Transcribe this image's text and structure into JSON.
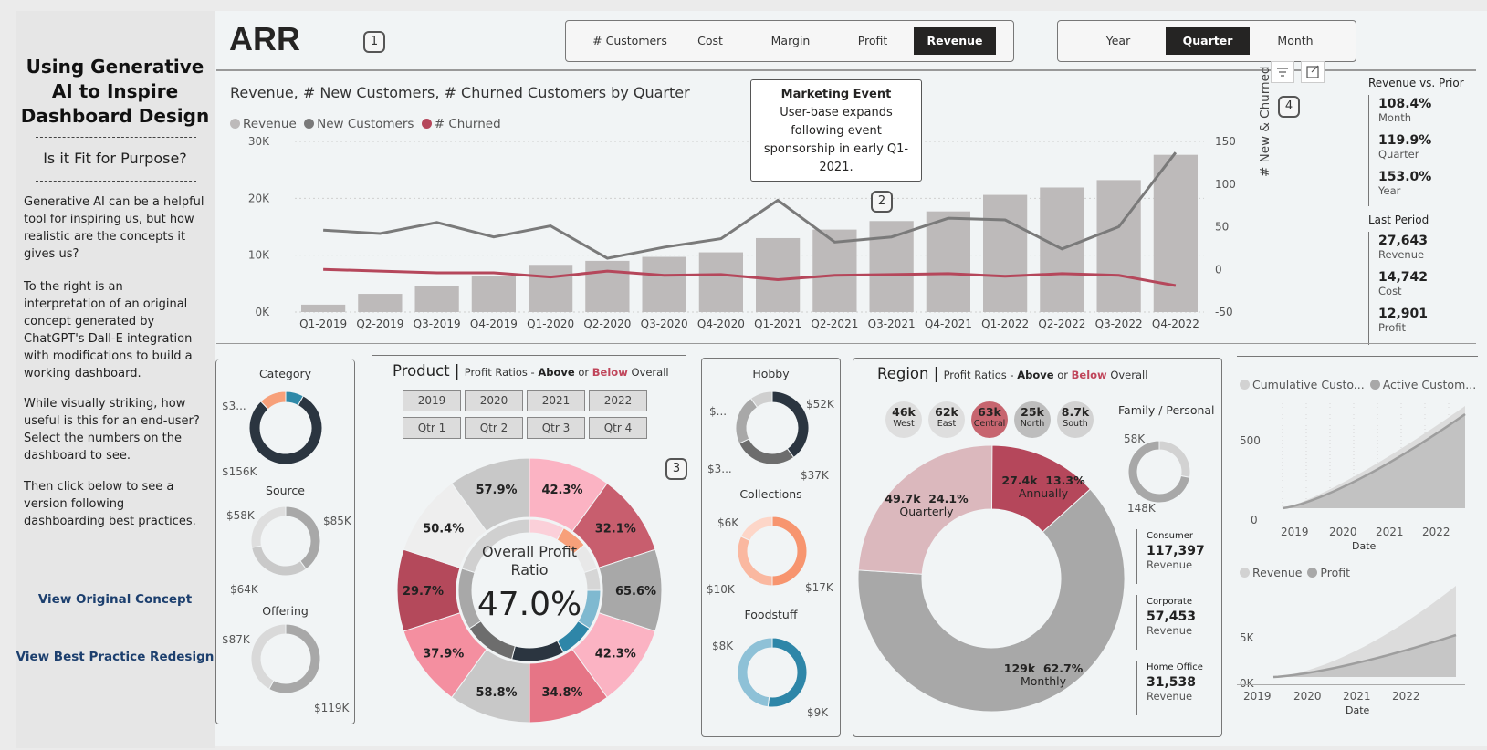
{
  "sidebar": {
    "title_lines": [
      "Using Generative",
      "AI to Inspire",
      "Dashboard Design"
    ],
    "subtitle": "Is it Fit for Purpose?",
    "para1": "Generative AI can be a helpful tool for inspiring us, but how realistic are the concepts it gives us?",
    "para2": "To the right is an interpretation of an original concept generated by ChatGPT's Dall-E integration with modifications to build a working dashboard.",
    "para3": "While visually striking, how useful is this for an end-user? Select the numbers on the dashboard to see.",
    "para4": "Then click below to see a version following dashboarding best practices.",
    "link_original": "View Original Concept",
    "link_redesign": "View Best Practice Redesign"
  },
  "header": {
    "title": "ARR",
    "badges": [
      "1",
      "2",
      "3",
      "4"
    ],
    "metric_buttons": [
      "# Customers",
      "Cost",
      "Margin",
      "Profit",
      "Revenue"
    ],
    "metric_active": "Revenue",
    "period_buttons": [
      "Year",
      "Quarter",
      "Month"
    ],
    "period_active": "Quarter"
  },
  "main_chart": {
    "title": "Revenue, # New Customers, # Churned Customers by Quarter",
    "legend": [
      {
        "label": "Revenue",
        "color": "#bdbaba"
      },
      {
        "label": "New Customers",
        "color": "#7a7a7a"
      },
      {
        "label": "# Churned",
        "color": "#b5475b"
      }
    ],
    "y_left_ticks": [
      "30K",
      "20K",
      "10K",
      "0K"
    ],
    "y_right_ticks": [
      "150",
      "100",
      "50",
      "0",
      "-50"
    ],
    "y_right_label": "# New & Churned",
    "annotation": {
      "title": "Marketing Event",
      "lines": [
        "User-base expands",
        "following event",
        "sponsorship in early Q1-",
        "2021."
      ]
    }
  },
  "chart_data": {
    "type": "bar",
    "categories": [
      "Q1-2019",
      "Q2-2019",
      "Q3-2019",
      "Q4-2019",
      "Q1-2020",
      "Q2-2020",
      "Q3-2020",
      "Q4-2020",
      "Q1-2021",
      "Q2-2021",
      "Q3-2021",
      "Q4-2021",
      "Q1-2022",
      "Q2-2022",
      "Q3-2022",
      "Q4-2022"
    ],
    "series": [
      {
        "name": "Revenue",
        "type": "bar",
        "values": [
          1300,
          3200,
          4600,
          6300,
          8300,
          9000,
          9700,
          10500,
          13000,
          14500,
          16000,
          17700,
          20600,
          21900,
          23200,
          27643
        ]
      },
      {
        "name": "New Customers",
        "type": "line",
        "values": [
          46,
          42,
          55,
          38,
          51,
          13,
          26,
          36,
          81,
          32,
          38,
          60,
          58,
          24,
          50,
          137
        ]
      },
      {
        "name": "# Churned",
        "type": "line",
        "values": [
          0,
          -2,
          -4,
          -4,
          -9,
          -2,
          -7,
          -6,
          -12,
          -7,
          -6,
          -5,
          -8,
          -5,
          -7,
          -19
        ]
      }
    ],
    "ylim": [
      0,
      30000
    ],
    "y2lim": [
      -50,
      150
    ],
    "ylabel": "",
    "y2label": "# New & Churned"
  },
  "kpis": {
    "header": "Revenue vs. Prior",
    "items": [
      {
        "value": "108.4%",
        "label": "Month"
      },
      {
        "value": "119.9%",
        "label": "Quarter"
      },
      {
        "value": "153.0%",
        "label": "Year"
      }
    ],
    "last_header": "Last Period",
    "last_items": [
      {
        "value": "27,643",
        "label": "Revenue"
      },
      {
        "value": "14,742",
        "label": "Cost"
      },
      {
        "value": "12,901",
        "label": "Profit"
      }
    ]
  },
  "left_donuts": {
    "category": {
      "title": "Category",
      "labels": [
        "$3...",
        "$156K"
      ]
    },
    "source": {
      "title": "Source",
      "labels": [
        "$58K",
        "$85K",
        "$64K"
      ]
    },
    "offering": {
      "title": "Offering",
      "labels": [
        "$87K",
        "$119K"
      ]
    }
  },
  "product": {
    "title": "Product",
    "subtitle_pre": "Profit Ratios - ",
    "above": "Above",
    "or": " or ",
    "below": "Below",
    "subtitle_post": " Overall",
    "years": [
      "2019",
      "2020",
      "2021",
      "2022"
    ],
    "quarters": [
      "Qtr 1",
      "Qtr 2",
      "Qtr 3",
      "Qtr 4"
    ],
    "center_label_1": "Overall Profit",
    "center_label_2": "Ratio",
    "center_value": "47.0%",
    "segments": [
      "42.3%",
      "32.1%",
      "65.6%",
      "42.3%",
      "34.8%",
      "58.8%",
      "37.9%",
      "29.7%",
      "50.4%",
      "57.9%"
    ]
  },
  "right_donuts": {
    "hobby": {
      "title": "Hobby",
      "labels": [
        "$52K",
        "$...",
        "$3...",
        "$37K"
      ]
    },
    "collections": {
      "title": "Collections",
      "labels": [
        "$6K",
        "$10K",
        "$17K"
      ]
    },
    "foodstuff": {
      "title": "Foodstuff",
      "labels": [
        "$8K",
        "$9K"
      ]
    }
  },
  "region": {
    "title": "Region",
    "subtitle_pre": "Profit Ratios - ",
    "above": "Above",
    "or": " or ",
    "below": "Below",
    "subtitle_post": " Overall",
    "bubbles": [
      {
        "value": "46k",
        "label": "West"
      },
      {
        "value": "62k",
        "label": "East"
      },
      {
        "value": "63k",
        "label": "Central"
      },
      {
        "value": "25k",
        "label": "North"
      },
      {
        "value": "8.7k",
        "label": "South"
      }
    ],
    "donut": [
      {
        "value": "27.4k",
        "pct": "13.3%",
        "label": "Annually"
      },
      {
        "value": "129k",
        "pct": "62.7%",
        "label": "Monthly"
      },
      {
        "value": "49.7k",
        "pct": "24.1%",
        "label": "Quarterly"
      }
    ],
    "family_title": "Family / Personal",
    "family_labels": [
      "58K",
      "148K"
    ],
    "segments": [
      {
        "name": "Consumer",
        "value": "117,397",
        "label": "Revenue"
      },
      {
        "name": "Corporate",
        "value": "57,453",
        "label": "Revenue"
      },
      {
        "name": "Home Office",
        "value": "31,538",
        "label": "Revenue"
      }
    ]
  },
  "small_charts": {
    "top": {
      "legend": [
        "Cumulative Custo...",
        "Active Custom..."
      ],
      "yticks": [
        "500",
        "0"
      ],
      "xticks": [
        "2019",
        "2020",
        "2021",
        "2022"
      ],
      "xlabel": "Date"
    },
    "bottom": {
      "legend": [
        "Revenue",
        "Profit"
      ],
      "yticks": [
        "5K",
        "0K"
      ],
      "xticks": [
        "2019",
        "2020",
        "2021",
        "2022"
      ],
      "xlabel": "Date"
    }
  }
}
